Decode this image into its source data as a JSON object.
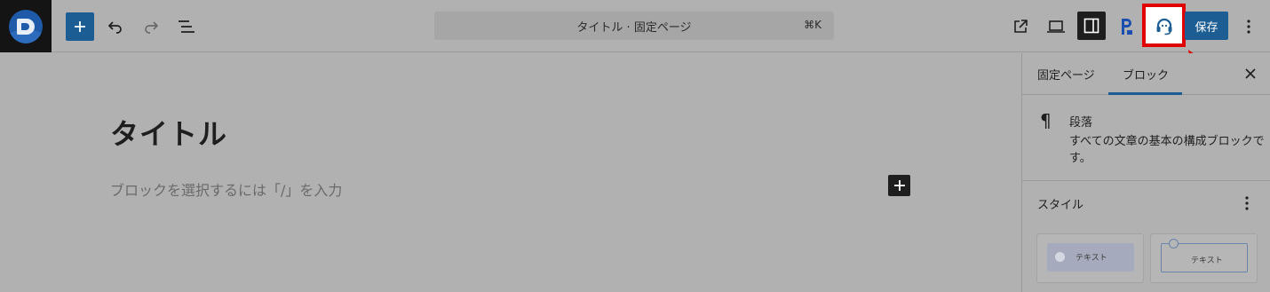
{
  "topbar": {
    "command_label": "タイトル · 固定ページ",
    "command_shortcut": "⌘K",
    "save_label": "保存"
  },
  "editor": {
    "title": "タイトル",
    "paragraph_placeholder": "ブロックを選択するには「/」を入力"
  },
  "sidebar": {
    "tabs": [
      {
        "label": "固定ページ"
      },
      {
        "label": "ブロック",
        "active": true
      }
    ],
    "block": {
      "name": "段落",
      "description": "すべての文章の基本の構成ブロックです。",
      "icon": "¶"
    },
    "styles": {
      "label": "スタイル",
      "options": [
        {
          "label": "テキスト"
        },
        {
          "label": "テキスト"
        }
      ]
    }
  },
  "colors": {
    "accent": "#1c5d93",
    "highlight": "#e00000",
    "overlay": "#b1b1b1"
  }
}
